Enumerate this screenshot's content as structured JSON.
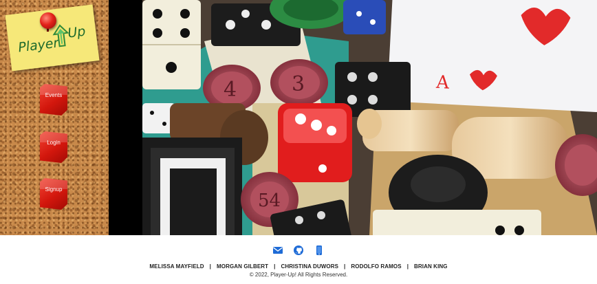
{
  "logo": {
    "word1": "Player",
    "word2": "Up"
  },
  "nav": [
    {
      "label": "Events"
    },
    {
      "label": "Login"
    },
    {
      "label": "Signup"
    }
  ],
  "footer": {
    "icons": [
      "envelope-icon",
      "github-icon",
      "mobile-phone-icon"
    ],
    "names": [
      "MELISSA MAYFIELD",
      "MORGAN GILBERT",
      "CHRISTINA DUWORS",
      "RODOLFO RAMOS",
      "BRIAN KING"
    ],
    "separator": "|",
    "copyright": "© 2022, Player-Up! All Rights Reserved."
  },
  "colors": {
    "accent": "#1e6bd6",
    "cube_red": "#d3170d",
    "note_yellow": "#f6e879",
    "logo_green": "#1e6a2c"
  }
}
